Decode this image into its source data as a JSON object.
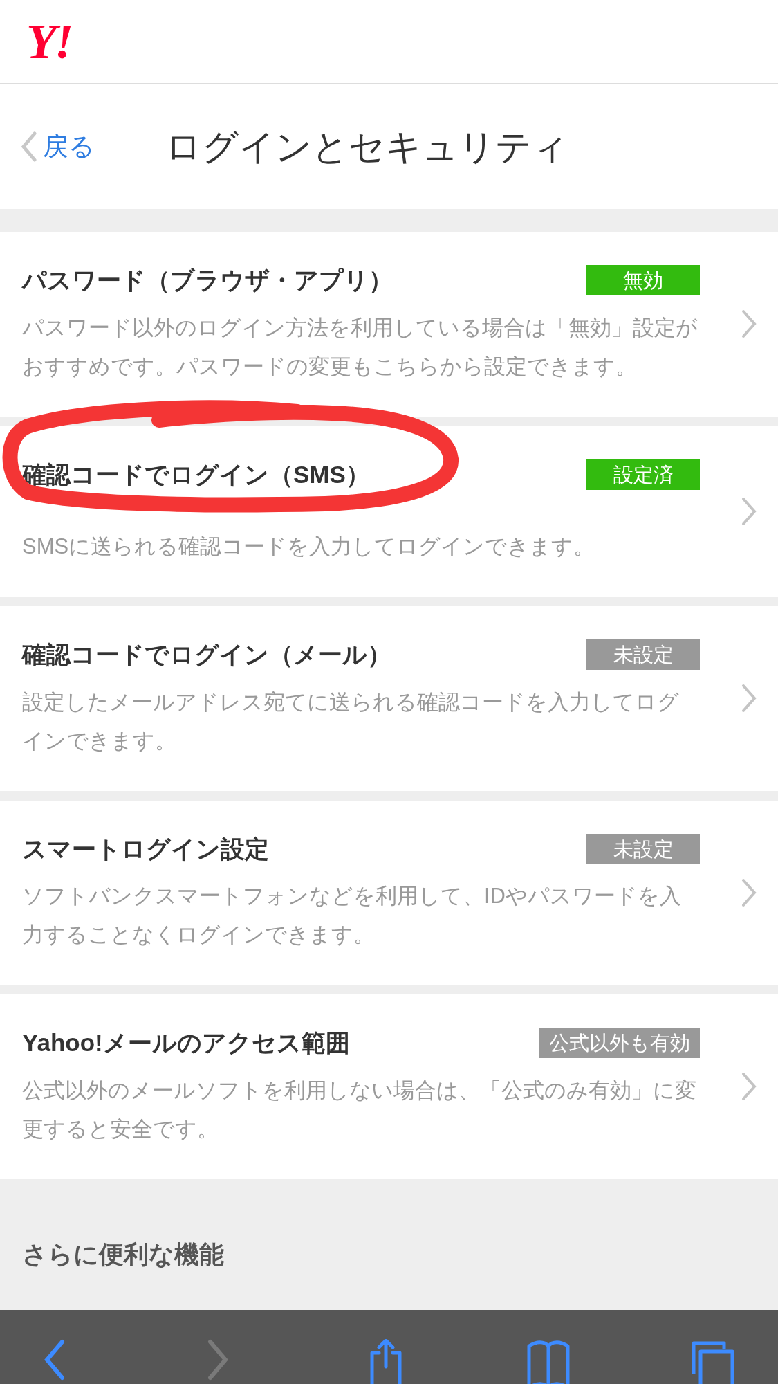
{
  "header": {
    "logo": "Y!"
  },
  "nav": {
    "back": "戻る",
    "title": "ログインとセキュリティ"
  },
  "cards": [
    {
      "title": "パスワード（ブラウザ・アプリ）",
      "badge": "無効",
      "color": "#33bb0f",
      "description": "パスワード以外のログイン方法を利用している場合は「無効」設定がおすすめです。パスワードの変更もこちらから設定できます。",
      "circled": false
    },
    {
      "title": "確認コードでログイン（SMS）",
      "badge": "設定済",
      "color": "#33bb0f",
      "description": "SMSに送られる確認コードを入力してログインできます。",
      "circled": true
    },
    {
      "title": "確認コードでログイン（メール）",
      "badge": "未設定",
      "color": "#999999",
      "description": "設定したメールアドレス宛てに送られる確認コードを入力してログインできます。",
      "circled": false
    },
    {
      "title": "スマートログイン設定",
      "badge": "未設定",
      "color": "#999999",
      "description": "ソフトバンクスマートフォンなどを利用して、IDやパスワードを入力することなくログインできます。",
      "circled": false
    },
    {
      "title": "Yahoo!メールのアクセス範囲",
      "badge": "公式以外も有効",
      "color": "#999999",
      "description": "公式以外のメールソフトを利用しない場合は、「公式のみ有効」に変更すると安全です。",
      "circled": false
    }
  ],
  "more_heading": "さらに便利な機能",
  "toolbar": [
    {
      "kind": "back",
      "disabled": false
    },
    {
      "kind": "forward",
      "disabled": true
    },
    {
      "kind": "share",
      "disabled": false
    },
    {
      "kind": "bookmarks",
      "disabled": false
    },
    {
      "kind": "tabs",
      "disabled": false
    }
  ]
}
